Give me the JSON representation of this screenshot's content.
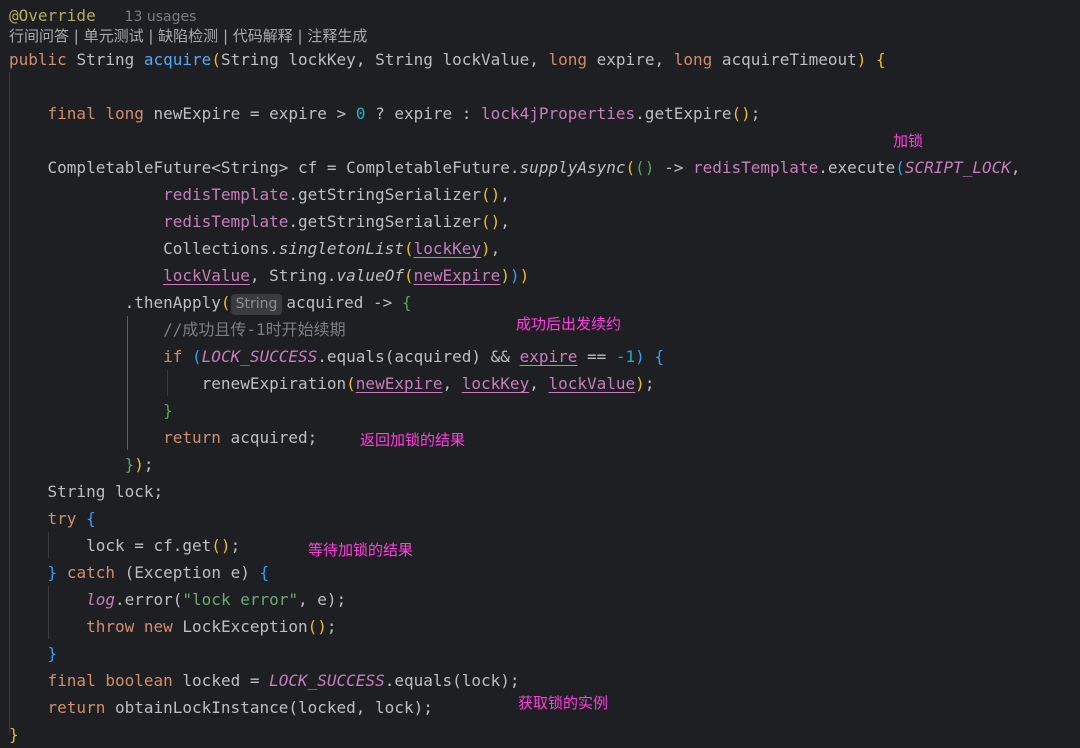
{
  "header": {
    "annotation": "@Override",
    "usages": "13 usages",
    "codelens": "行间问答 | 单元测试 | 缺陷检测 | 代码解释 | 注释生成"
  },
  "code": {
    "sig_public": "public",
    "sig_type": "String",
    "sig_name": "acquire",
    "sig_params_1": "String lockKey, String lockValue,",
    "sig_long": "long",
    "sig_expire": "expire,",
    "sig_timeout": "acquireTimeout",
    "final": "final",
    "long": "long",
    "newExpire_decl": "newExpire = expire > ",
    "zero": "0",
    "ternary": " ? expire : ",
    "lock4j": "lock4jProperties",
    "getExpire": ".getExpire",
    "cf_decl_1": "CompletableFuture<String> cf = CompletableFuture.",
    "supplyAsync": "supplyAsync",
    "arrow": "() -> ",
    "redisTemplate": "redisTemplate",
    "execute": ".execute",
    "script_lock": "SCRIPT_LOCK",
    "getStringSerializer": ".getStringSerializer",
    "collections": "Collections.",
    "singletonList": "singletonList",
    "lockKey": "lockKey",
    "lockValue": "lockValue",
    "stringValueOf": ", String.",
    "valueOf": "valueOf",
    "newExpire": "newExpire",
    "thenApply": ".thenApply",
    "hint_string": "String",
    "acquired_arrow": "acquired -> ",
    "comment": "//成功且传-1时开始续期",
    "if": "if",
    "lock_success": "LOCK_SUCCESS",
    "equals_acquired": ".equals(acquired) && ",
    "expire": "expire",
    "eq_neg1": " == ",
    "neg1": "-1",
    "renew": "renewExpiration",
    "comma": ", ",
    "return": "return",
    "acquired_semi": " acquired;",
    "close_then": "});",
    "string_lock": "String lock;",
    "try": "try",
    "lock_get": "lock = cf.get",
    "catch": "catch",
    "exception": "(Exception e) ",
    "log": "log",
    "error": ".error(",
    "lock_error": "\"lock error\"",
    "e_close": ", e);",
    "throw": "throw",
    "new": "new",
    "lock_exception": " LockException",
    "boolean": "boolean",
    "locked_eq": " locked = ",
    "equals_lock": ".equals(lock);",
    "obtain": " obtainLockInstance(locked, lock);"
  },
  "notes": {
    "lock": "加锁",
    "success_renew": "成功后出发续约",
    "return_result": "返回加锁的结果",
    "wait_result": "等待加锁的结果",
    "get_instance": "获取锁的实例"
  }
}
